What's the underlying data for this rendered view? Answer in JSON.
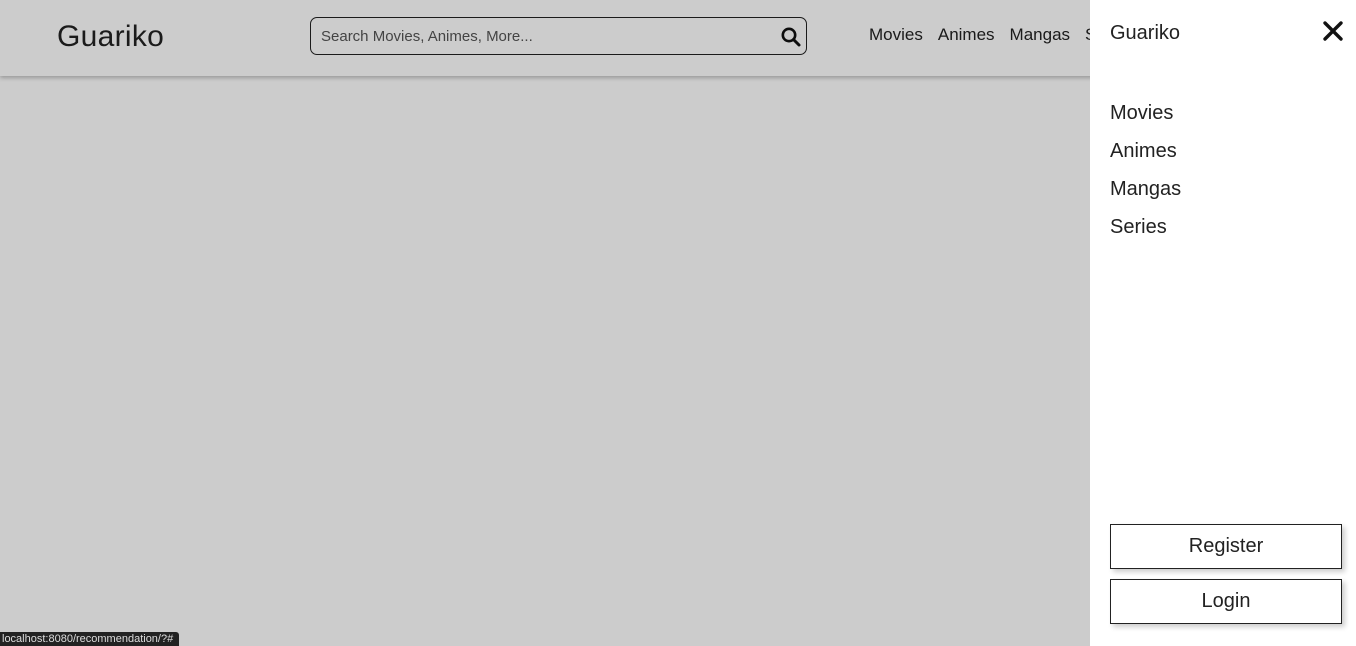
{
  "header": {
    "brand": "Guariko",
    "search": {
      "placeholder": "Search Movies, Animes, More...",
      "value": ""
    },
    "nav": [
      "Movies",
      "Animes",
      "Mangas",
      "S"
    ]
  },
  "drawer": {
    "title": "Guariko",
    "links": [
      "Movies",
      "Animes",
      "Mangas",
      "Series"
    ],
    "register_label": "Register",
    "login_label": "Login"
  },
  "status_bar": {
    "url": "localhost:8080/recommendation/?#"
  },
  "colors": {
    "overlay": "rgba(0,0,0,0.2)",
    "text": "#222222",
    "background": "#ffffff"
  },
  "icons": {
    "search": "search-icon",
    "close": "close-icon"
  }
}
